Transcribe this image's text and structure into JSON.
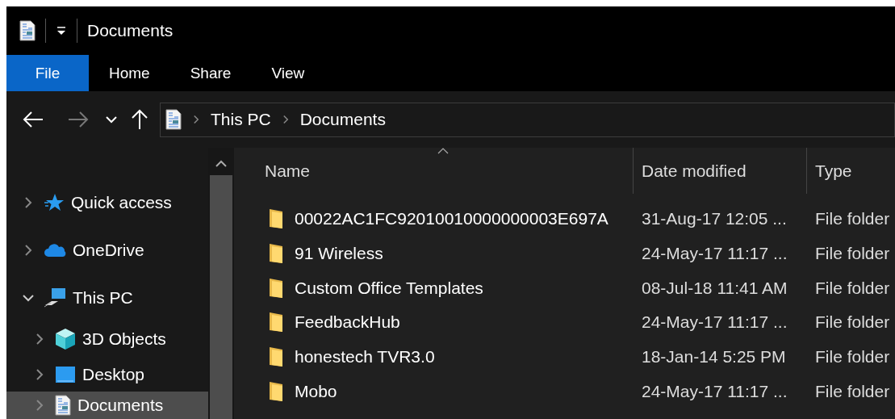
{
  "window": {
    "title": "Documents"
  },
  "ribbon_tabs": [
    {
      "label": "File",
      "selected": true
    },
    {
      "label": "Home",
      "selected": false
    },
    {
      "label": "Share",
      "selected": false
    },
    {
      "label": "View",
      "selected": false
    }
  ],
  "navigation": {
    "back": {
      "disabled": false
    },
    "forward": {
      "disabled": true
    }
  },
  "breadcrumb": [
    "This PC",
    "Documents"
  ],
  "nav_pane": {
    "items": [
      {
        "kind": "star",
        "label": "Quick access",
        "expanded": false,
        "selected": false
      },
      {
        "kind": "cloud",
        "label": "OneDrive",
        "expanded": false,
        "selected": false
      },
      {
        "kind": "computer",
        "label": "This PC",
        "expanded": true,
        "selected": false,
        "children": [
          {
            "kind": "cube",
            "label": "3D Objects",
            "expanded": false,
            "selected": false
          },
          {
            "kind": "desktop",
            "label": "Desktop",
            "expanded": false,
            "selected": false
          },
          {
            "kind": "document",
            "label": "Documents",
            "expanded": false,
            "selected": true
          }
        ]
      }
    ]
  },
  "file_list": {
    "columns": [
      {
        "label": "Name",
        "sorted": true
      },
      {
        "label": "Date modified",
        "sorted": false
      },
      {
        "label": "Type",
        "sorted": false
      }
    ],
    "rows": [
      {
        "name": "00022AC1FC92010010000000003E697A",
        "date_modified": "31-Aug-17 12:05 ...",
        "type": "File folder"
      },
      {
        "name": "91 Wireless",
        "date_modified": "24-May-17 11:17 ...",
        "type": "File folder"
      },
      {
        "name": "Custom Office Templates",
        "date_modified": "08-Jul-18 11:41 AM",
        "type": "File folder"
      },
      {
        "name": "FeedbackHub",
        "date_modified": "24-May-17 11:17 ...",
        "type": "File folder"
      },
      {
        "name": "honestech TVR3.0",
        "date_modified": "18-Jan-14 5:25 PM",
        "type": "File folder"
      },
      {
        "name": "Mobo",
        "date_modified": "24-May-17 11:17 ...",
        "type": "File folder"
      }
    ]
  }
}
